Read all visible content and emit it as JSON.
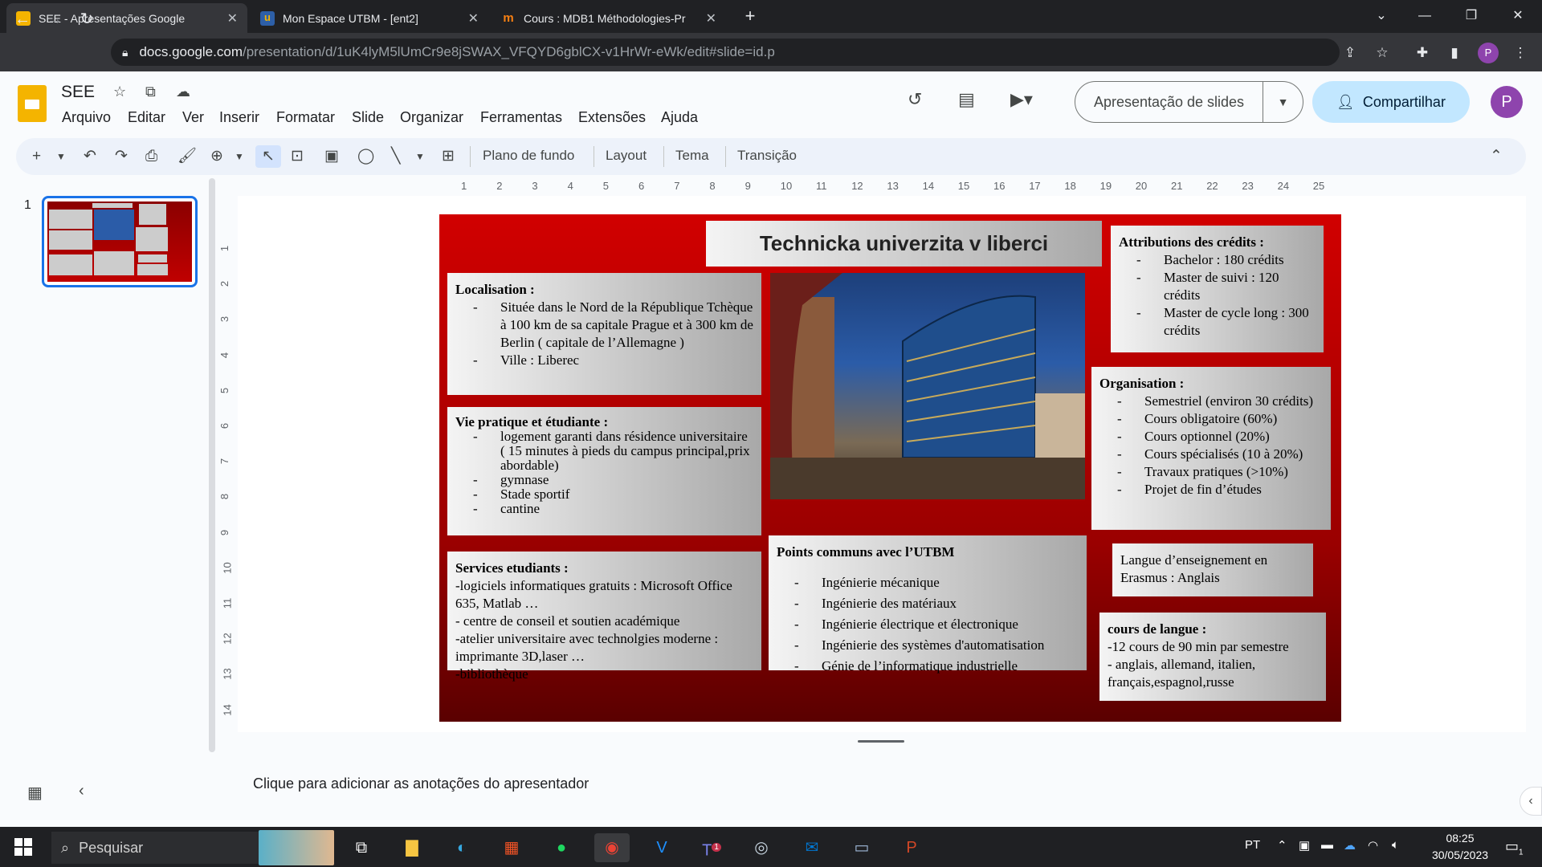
{
  "browser": {
    "tabs": [
      {
        "title": "SEE - Apresentações Google",
        "active": true,
        "icon": "google-slides-icon"
      },
      {
        "title": "Mon Espace UTBM - [ent2]",
        "active": false,
        "icon": "utbm-icon"
      },
      {
        "title": "Cours : MDB1 Méthodologies-Pr",
        "active": false,
        "icon": "moodle-icon"
      }
    ],
    "url_domain": "docs.google.com",
    "url_path": "/presentation/d/1uK4lyM5lUmCr9e8jSWAX_VFQYD6gblCX-v1HrWr-eWk/edit#slide=id.p",
    "profile_initial": "P"
  },
  "doc": {
    "title": "SEE",
    "menu": [
      "Arquivo",
      "Editar",
      "Ver",
      "Inserir",
      "Formatar",
      "Slide",
      "Organizar",
      "Ferramentas",
      "Extensões",
      "Ajuda"
    ],
    "present_label": "Apresentação de slides",
    "share_label": "Compartilhar",
    "avatar_initial": "P"
  },
  "toolbar": {
    "background": "Plano de fundo",
    "layout": "Layout",
    "theme": "Tema",
    "transition": "Transição"
  },
  "filmstrip": {
    "slide_number": "1"
  },
  "ruler": {
    "h": [
      "1",
      "2",
      "3",
      "4",
      "5",
      "6",
      "7",
      "8",
      "9",
      "10",
      "11",
      "12",
      "13",
      "14",
      "15",
      "16",
      "17",
      "18",
      "19",
      "20",
      "21",
      "22",
      "23",
      "24",
      "25"
    ],
    "v": [
      "1",
      "2",
      "3",
      "4",
      "5",
      "6",
      "7",
      "8",
      "9",
      "10",
      "11",
      "12",
      "13",
      "14"
    ]
  },
  "slide": {
    "title": "Technicka univerzita v liberci",
    "localisation": {
      "heading": "Localisation :",
      "items": [
        "Située dans le Nord de la République Tchèque à 100 km de sa capitale Prague et à 300 km de Berlin ( capitale de l’Allemagne )",
        "Ville : Liberec"
      ]
    },
    "vie": {
      "heading": "Vie pratique et étudiante :",
      "items": [
        "logement garanti dans résidence universitaire ( 15 minutes à pieds du campus principal,prix abordable)",
        "gymnase",
        "Stade sportif",
        "cantine"
      ]
    },
    "services": {
      "heading": "Services etudiants :",
      "lines": [
        "-logiciels informatiques gratuits : Microsoft Office 635, Matlab …",
        "- centre de conseil et soutien académique",
        "-atelier universitaire avec technolgies moderne : imprimante 3D,laser …",
        "-bibliothèque"
      ]
    },
    "communs": {
      "heading": "Points communs avec l’UTBM",
      "items": [
        "Ingénierie mécanique",
        "Ingénierie des matériaux",
        "Ingénierie électrique et électronique",
        "Ingénierie des systèmes d'automatisation",
        "Génie de l’informatique industrielle"
      ]
    },
    "credits": {
      "heading": "Attributions des crédits :",
      "items": [
        "Bachelor : 180 crédits",
        "Master de suivi : 120 crédits",
        "Master de cycle long : 300 crédits"
      ]
    },
    "organisation": {
      "heading": "Organisation :",
      "items": [
        "Semestriel (environ 30 crédits)",
        "Cours obligatoire (60%)",
        "Cours optionnel (20%)",
        "Cours spécialisés (10 à 20%)",
        "Travaux pratiques (>10%)",
        "Projet de fin d’études"
      ]
    },
    "langue": "Langue d’enseignement en Erasmus : Anglais",
    "cours": {
      "heading": "cours de langue :",
      "lines": [
        "-12 cours de 90 min par semestre",
        "- anglais, allemand, italien, français,espagnol,russe"
      ]
    }
  },
  "notes_placeholder": "Clique para adicionar as anotações do apresentador",
  "taskbar": {
    "search_placeholder": "Pesquisar",
    "lang": "PT",
    "time": "08:25",
    "date": "30/05/2023",
    "notification_count": "1",
    "teams_badge": "1"
  },
  "colors": {
    "accent": "#1a73e8",
    "share_bg": "#c2e7ff",
    "slide_red": "#c00000"
  }
}
